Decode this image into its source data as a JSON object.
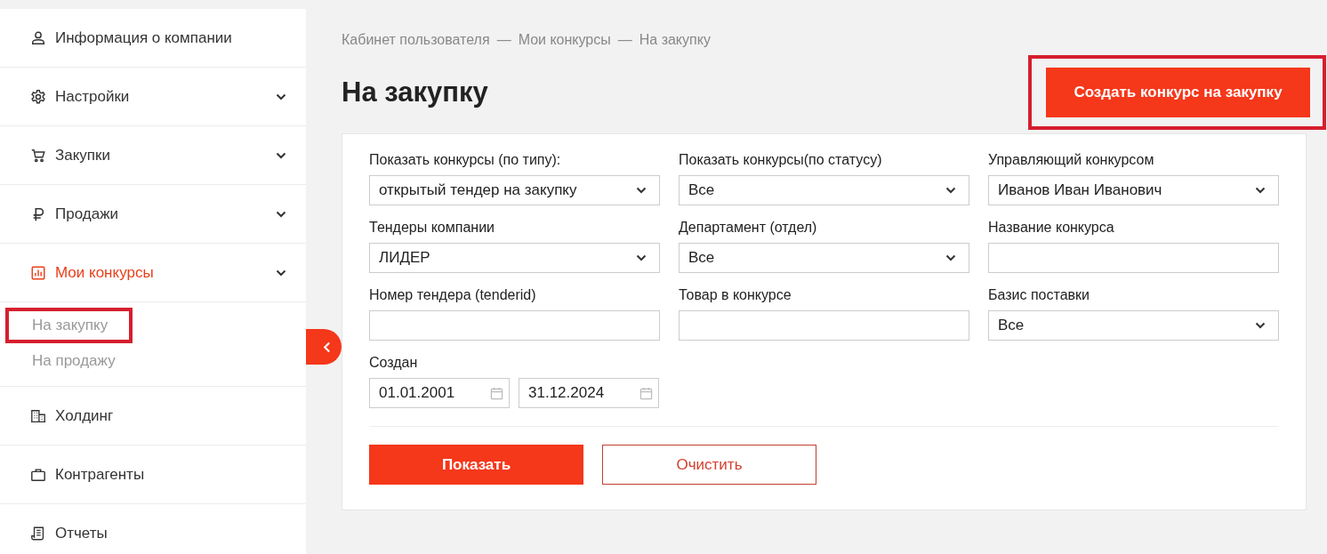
{
  "sidebar": {
    "items": [
      {
        "label": "Информация о компании",
        "kind": "person",
        "expandable": false,
        "active": false
      },
      {
        "label": "Настройки",
        "kind": "gear",
        "expandable": true,
        "active": false
      },
      {
        "label": "Закупки",
        "kind": "cart",
        "expandable": true,
        "active": false
      },
      {
        "label": "Продажи",
        "kind": "ruble",
        "expandable": true,
        "active": false
      },
      {
        "label": "Мои конкурсы",
        "kind": "chart",
        "expandable": true,
        "active": true,
        "children": [
          {
            "label": "На закупку",
            "highlighted": true
          },
          {
            "label": "На продажу",
            "highlighted": false
          }
        ]
      },
      {
        "label": "Холдинг",
        "kind": "building",
        "expandable": false,
        "active": false
      },
      {
        "label": "Контрагенты",
        "kind": "briefcase",
        "expandable": false,
        "active": false
      },
      {
        "label": "Отчеты",
        "kind": "receipt",
        "expandable": false,
        "active": false
      }
    ]
  },
  "breadcrumb": [
    "Кабинет пользователя",
    "Мои конкурсы",
    "На закупку"
  ],
  "breadcrumb_separator": "—",
  "title": "На закупку",
  "create_button": {
    "label": "Создать конкурс на закупку",
    "highlighted": true
  },
  "filters": [
    {
      "label": "Показать конкурсы (по типу):",
      "kind": "select",
      "value": "открытый тендер на закупку"
    },
    {
      "label": "Показать конкурсы(по статусу)",
      "kind": "select",
      "value": "Все"
    },
    {
      "label": "Управляющий конкурсом",
      "kind": "select",
      "value": "Иванов Иван Иванович"
    },
    {
      "label": "Тендеры компании",
      "kind": "select",
      "value": "ЛИДЕР"
    },
    {
      "label": "Департамент (отдел)",
      "kind": "select",
      "value": "Все"
    },
    {
      "label": "Название конкурса",
      "kind": "text"
    },
    {
      "label": "Номер тендера (tenderid)",
      "kind": "text"
    },
    {
      "label": "Товар в конкурсе",
      "kind": "text"
    },
    {
      "label": "Базис поставки",
      "kind": "select",
      "value": "Все"
    },
    {
      "label": "Создан",
      "kind": "daterange",
      "values": [
        "01.01.2001",
        "31.12.2024"
      ]
    }
  ],
  "actions": [
    {
      "label": "Показать",
      "kind": "primary"
    },
    {
      "label": "Очистить",
      "kind": "outline"
    }
  ]
}
